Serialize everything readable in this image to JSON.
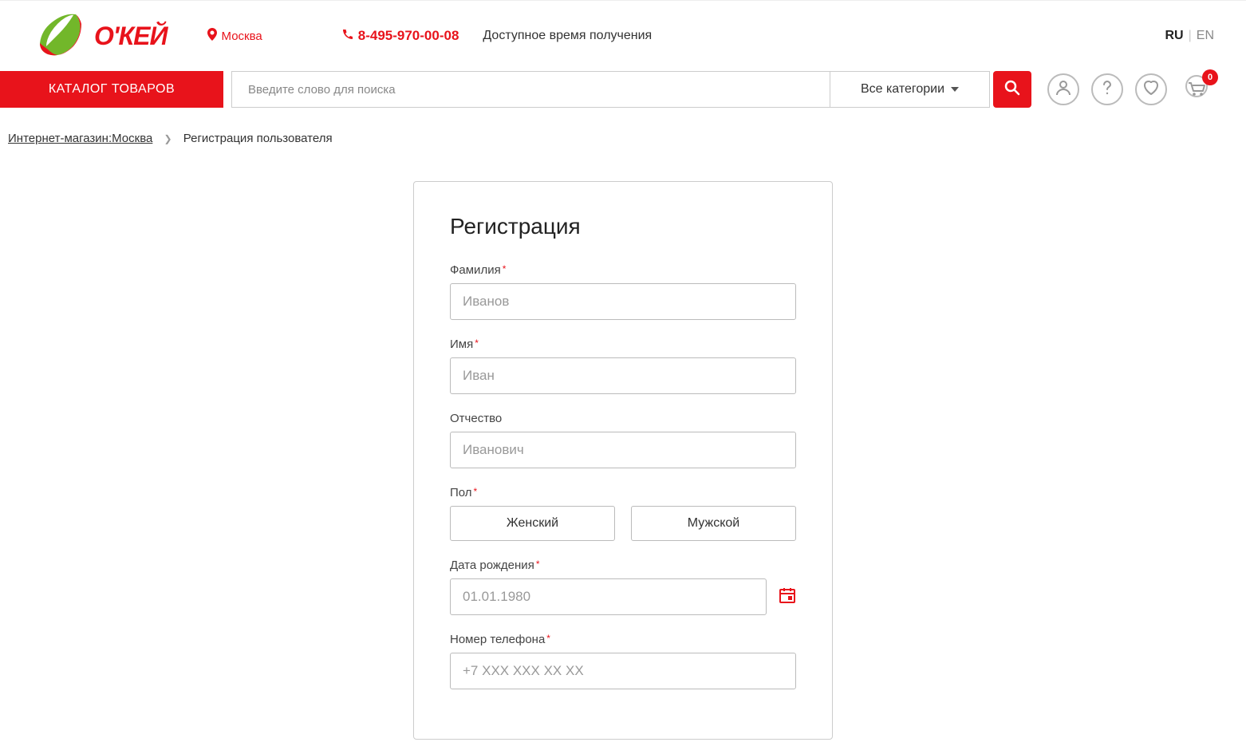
{
  "header": {
    "logo_text": "О'КЕЙ",
    "location": "Москва",
    "phone": "8-495-970-00-08",
    "delivery_info": "Доступное время получения",
    "lang_ru": "RU",
    "lang_en": "EN",
    "catalog_button": "КАТАЛОГ ТОВАРОВ",
    "search_placeholder": "Введите слово для поиска",
    "categories_label": "Все категории",
    "cart_count": "0"
  },
  "breadcrumb": {
    "home": "Интернет-магазин:Москва",
    "current": "Регистрация пользователя"
  },
  "form": {
    "title": "Регистрация",
    "lastname_label": "Фамилия",
    "lastname_placeholder": "Иванов",
    "firstname_label": "Имя",
    "firstname_placeholder": "Иван",
    "patronymic_label": "Отчество",
    "patronymic_placeholder": "Иванович",
    "gender_label": "Пол",
    "gender_female": "Женский",
    "gender_male": "Мужской",
    "birthdate_label": "Дата рождения",
    "birthdate_placeholder": "01.01.1980",
    "phone_label": "Номер телефона",
    "phone_placeholder": "+7 XXX XXX XX XX"
  }
}
